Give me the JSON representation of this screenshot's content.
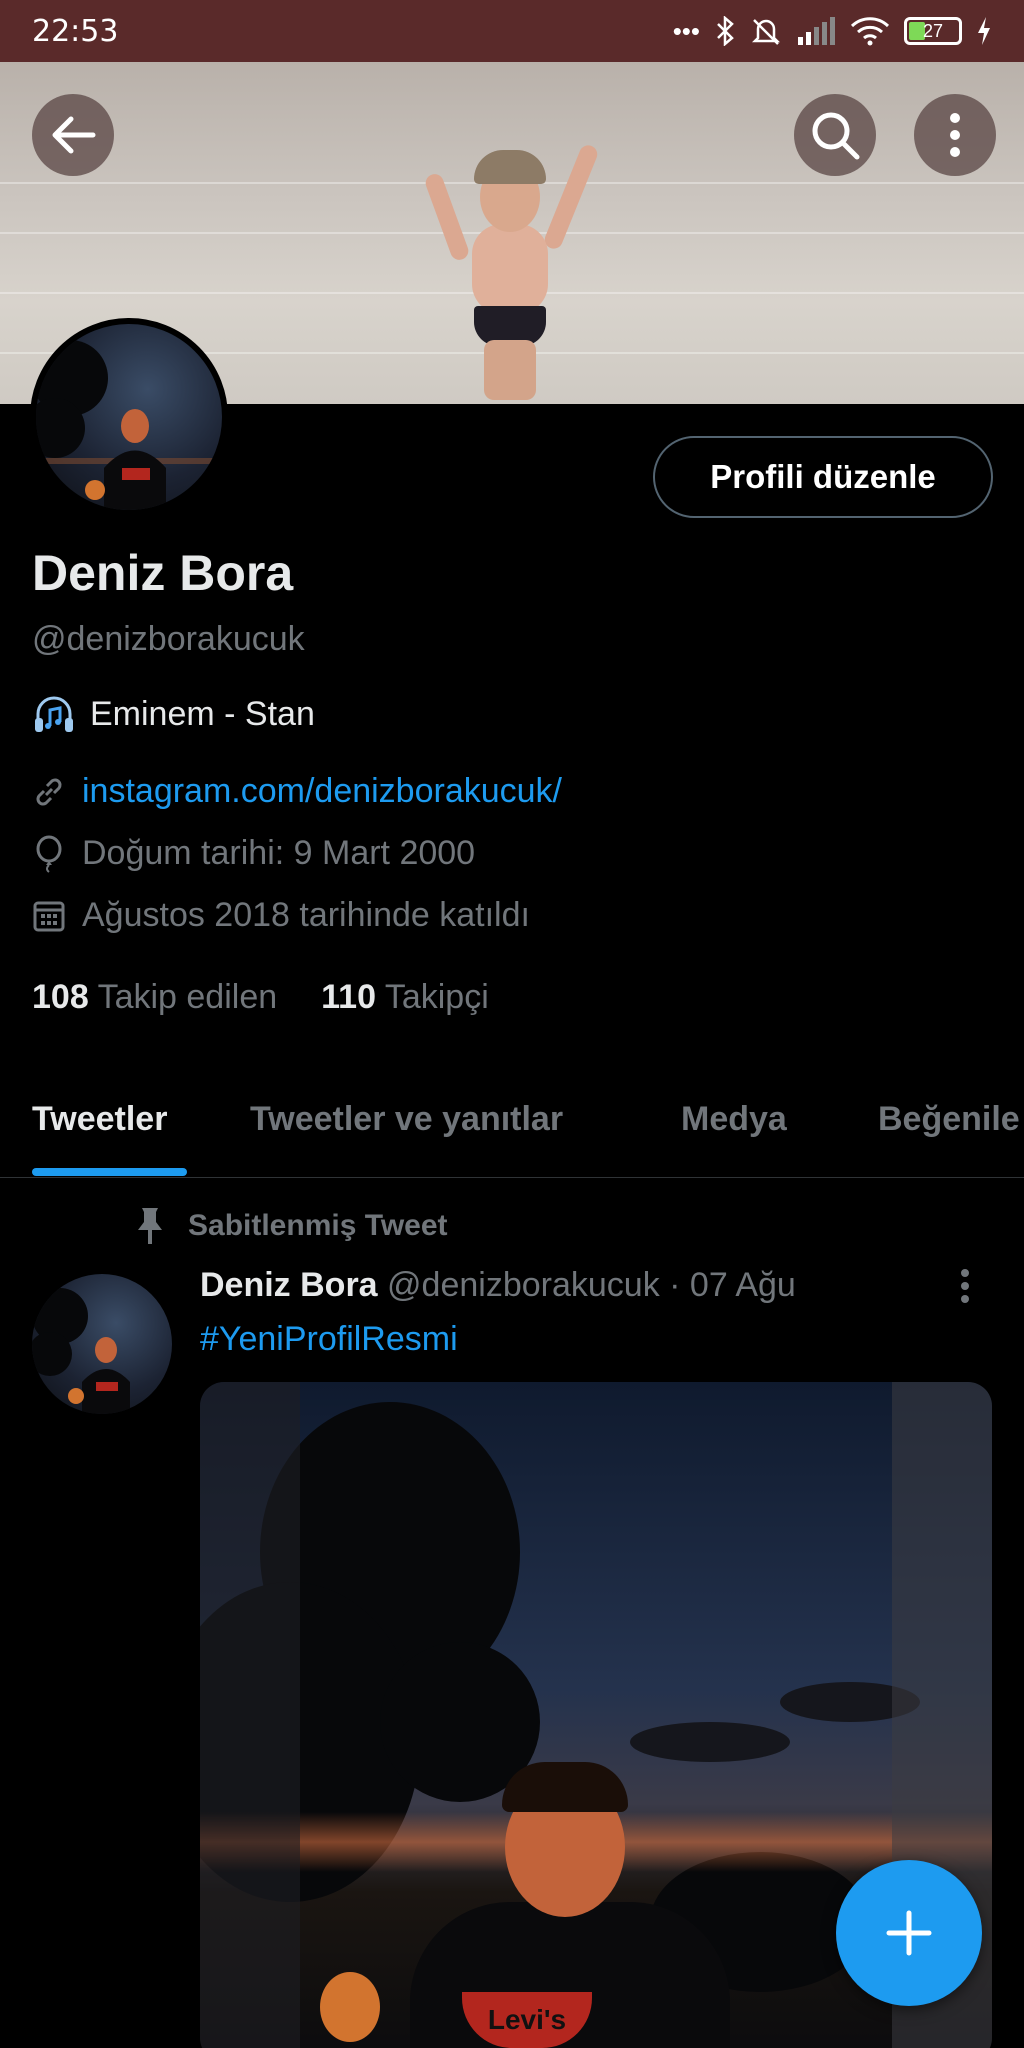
{
  "status_bar": {
    "time": "22:53",
    "dots": "•••",
    "battery": "27"
  },
  "profile": {
    "edit_button": "Profili düzenle",
    "name": "Deniz Bora",
    "handle": "@denizborakucuk",
    "bio": "Eminem - Stan",
    "link": "instagram.com/denizborakucuk/",
    "birthday": "Doğum tarihi: 9 Mart 2000",
    "joined": "Ağustos 2018 tarihinde katıldı",
    "following_count": "108",
    "following_label": "Takip edilen",
    "followers_count": "110",
    "followers_label": "Takipçi"
  },
  "tabs": [
    "Tweetler",
    "Tweetler ve yanıtlar",
    "Medya",
    "Beğenile"
  ],
  "pinned_tweet": {
    "pinned_label": "Sabitlenmiş Tweet",
    "author": "Deniz Bora",
    "handle_date": "@denizborakucuk · 07 Ağu",
    "hashtag": "#YeniProfilResmi",
    "image_logo_text": "Levi's"
  },
  "colors": {
    "accent": "#1d9bf0",
    "background": "#000000",
    "statusbar": "#5a2a2a",
    "muted": "#71767b"
  },
  "icons": [
    "back-arrow-icon",
    "search-icon",
    "more-vertical-icon",
    "music-headphones-icon",
    "link-icon",
    "balloon-icon",
    "calendar-icon",
    "pin-icon",
    "plus-icon"
  ]
}
